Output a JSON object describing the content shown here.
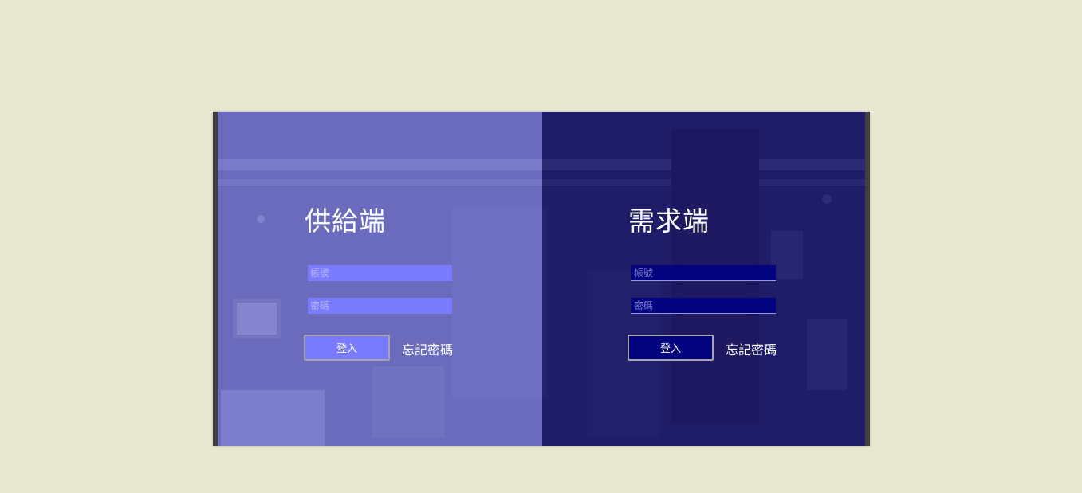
{
  "supply": {
    "title": "供給端",
    "account_placeholder": "帳號",
    "password_placeholder": "密碼",
    "login_label": "登入",
    "forgot_label": "忘記密碼"
  },
  "demand": {
    "title": "需求端",
    "account_placeholder": "帳號",
    "password_placeholder": "密碼",
    "login_label": "登入",
    "forgot_label": "忘記密碼"
  },
  "colors": {
    "page_background": "#e8e7cf",
    "supply_panel": "#7676d6",
    "demand_panel": "#1a186e",
    "supply_field": "#7b7bff",
    "demand_field": "#030380",
    "text": "#ffffff"
  }
}
